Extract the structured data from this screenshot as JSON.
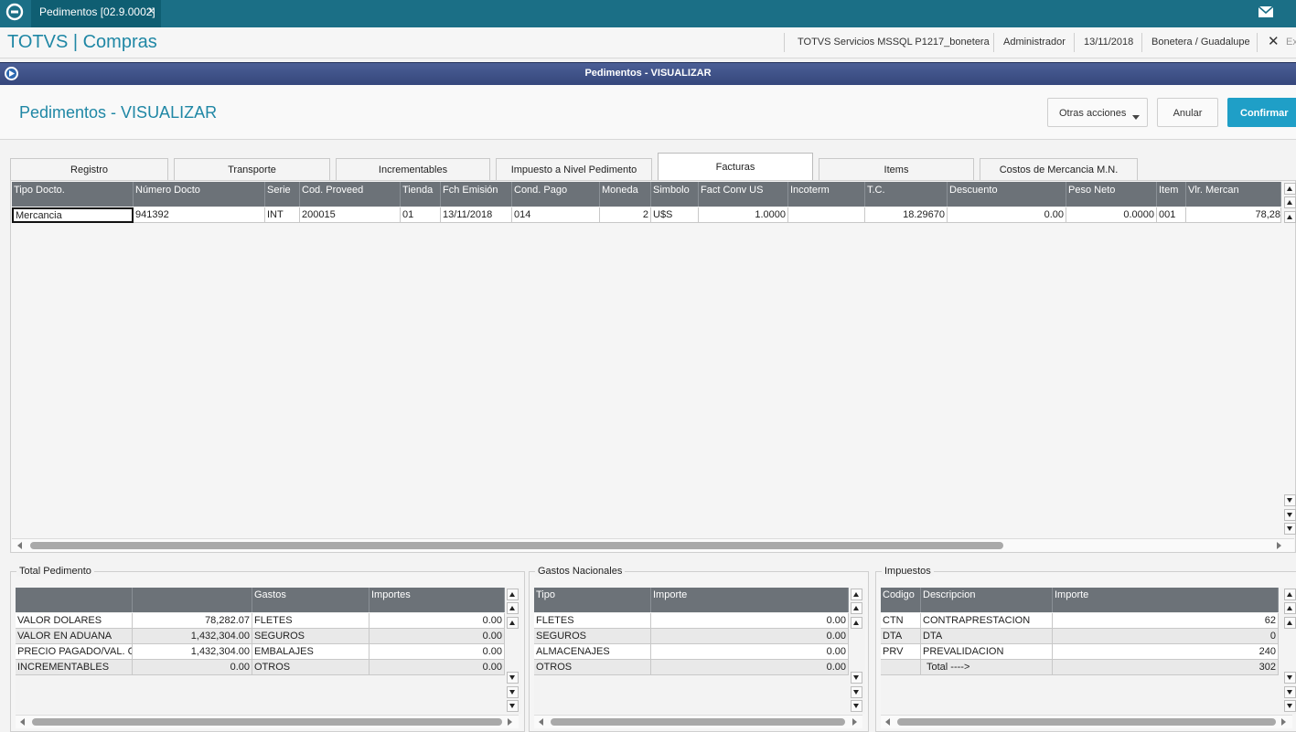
{
  "app_tab": {
    "title": "Pedimentos [02.9.0002]",
    "close": "×"
  },
  "header": {
    "brand": "TOTVS | Compras",
    "server": "TOTVS Servicios MSSQL P1217_bonetera",
    "user": "Administrador",
    "date": "13/11/2018",
    "branch": "Bonetera / Guadalupe",
    "exit_label": "Ex"
  },
  "dialog": {
    "title": "Pedimentos - VISUALIZAR"
  },
  "page": {
    "title": "Pedimentos - VISUALIZAR"
  },
  "actions": {
    "otras": "Otras acciones",
    "anular": "Anular",
    "confirmar": "Confirmar"
  },
  "tabs": [
    {
      "label": "Registro"
    },
    {
      "label": "Transporte"
    },
    {
      "label": "Incrementables"
    },
    {
      "label": "Impuesto a Nivel Pedimento"
    },
    {
      "label": "Facturas"
    },
    {
      "label": "Items"
    },
    {
      "label": "Costos de Mercancia M.N."
    }
  ],
  "active_tab": "Facturas",
  "facturas": {
    "headers": [
      "Tipo Docto.",
      "Número Docto",
      "Serie",
      "Cod. Proveed",
      "Tienda",
      "Fch Emisión",
      "Cond. Pago",
      "Moneda",
      "Simbolo",
      "Fact Conv US",
      "Incoterm",
      "T.C.",
      "Descuento",
      "Peso Neto",
      "Item",
      "Vlr. Mercan"
    ],
    "rows": [
      [
        "Mercancia",
        "941392",
        "INT",
        "200015",
        "01",
        "13/11/2018",
        "014",
        "2",
        "U$S",
        "1.0000",
        "",
        "18.29670",
        "0.00",
        "0.0000",
        "001",
        "78,28"
      ]
    ]
  },
  "total_pedimento": {
    "legend": "Total Pedimento",
    "headers": [
      "",
      "",
      "Gastos",
      "Importes"
    ],
    "rows": [
      [
        "VALOR DOLARES",
        "78,282.07",
        "FLETES",
        "0.00"
      ],
      [
        "VALOR EN ADUANA",
        "1,432,304.00",
        "SEGUROS",
        "0.00"
      ],
      [
        "PRECIO PAGADO/VAL. C(",
        "1,432,304.00",
        "EMBALAJES",
        "0.00"
      ],
      [
        "INCREMENTABLES",
        "0.00",
        "OTROS",
        "0.00"
      ]
    ]
  },
  "gastos_nacionales": {
    "legend": "Gastos Nacionales",
    "headers": [
      "Tipo",
      "Importe"
    ],
    "rows": [
      [
        "FLETES",
        "0.00"
      ],
      [
        "SEGUROS",
        "0.00"
      ],
      [
        "ALMACENAJES",
        "0.00"
      ],
      [
        "OTROS",
        "0.00"
      ]
    ]
  },
  "impuestos": {
    "legend": "Impuestos",
    "headers": [
      "Codigo",
      "Descripcion",
      "Importe"
    ],
    "rows": [
      [
        "CTN",
        "CONTRAPRESTACION",
        "62"
      ],
      [
        "DTA",
        "DTA",
        "0"
      ],
      [
        "PRV",
        "PREVALIDACION",
        "240"
      ],
      [
        "",
        "Total ---->",
        "302"
      ]
    ]
  },
  "colors": {
    "topbar": "#1b6f86",
    "brand": "#1f87a5",
    "confirm": "#1f9fc7",
    "grid_header": "#6c7278"
  },
  "icons": [
    "totvs-logo-icon",
    "close-icon",
    "mail-icon",
    "dialog-icon",
    "chevron-down-icon",
    "scroll-top-icon",
    "scroll-up-icon",
    "scroll-down-icon",
    "scroll-bottom-icon"
  ]
}
